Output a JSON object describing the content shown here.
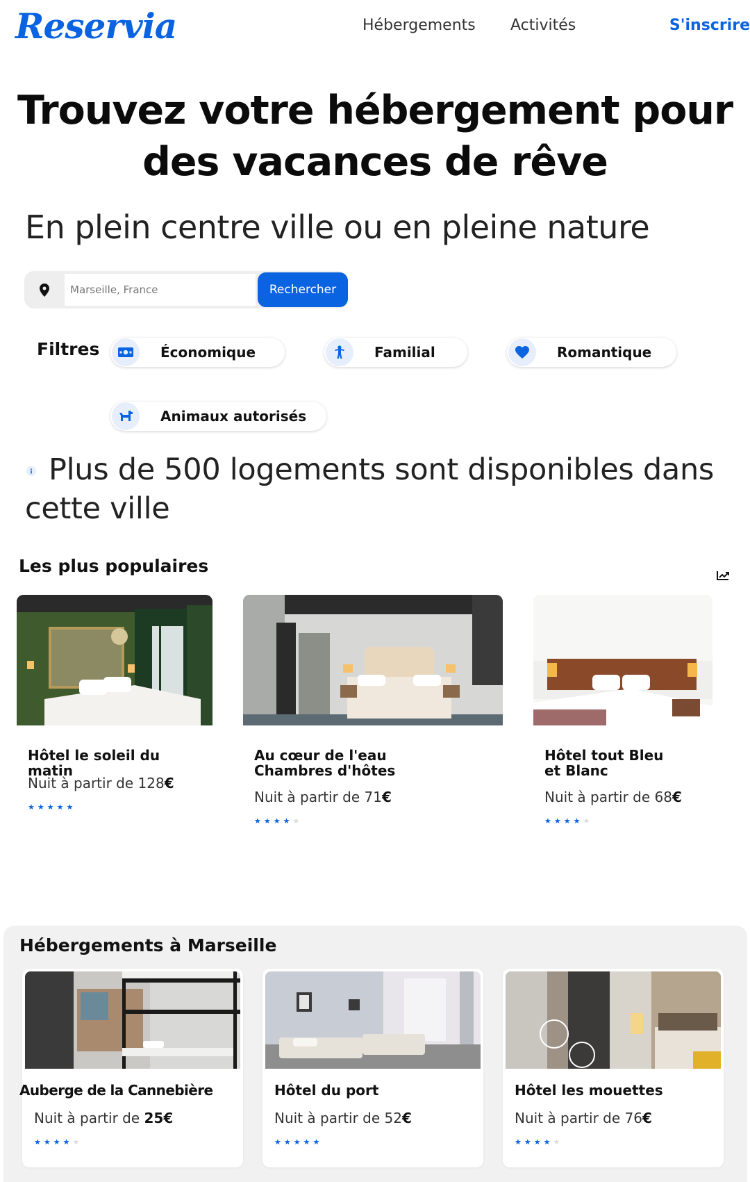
{
  "header": {
    "logo": "Reservia",
    "nav": [
      "Hébergements",
      "Activités"
    ],
    "signup": "S'inscrire"
  },
  "hero": {
    "title_line1": "Trouvez votre hébergement pour",
    "title_line2": "des vacances de rêve",
    "subtitle": "En plein centre ville ou en pleine nature"
  },
  "search": {
    "placeholder": "Marseille, France",
    "button": "Rechercher"
  },
  "filters": {
    "label": "Filtres",
    "items": [
      {
        "label": "Économique",
        "icon": "money-icon"
      },
      {
        "label": "Familial",
        "icon": "child-icon"
      },
      {
        "label": "Romantique",
        "icon": "heart-icon"
      },
      {
        "label": "Animaux autorisés",
        "icon": "dog-icon"
      }
    ]
  },
  "availability": "Plus de 500 logements sont disponibles dans cette ville",
  "popular": {
    "title": "Les plus populaires",
    "cards": [
      {
        "name": "Hôtel le soleil du matin",
        "price_prefix": "Nuit à partir de 128",
        "currency": "€",
        "rating": 5
      },
      {
        "name": "Au cœur de l'eau Chambres d'hôtes",
        "price_prefix": "Nuit à partir de 71",
        "currency": "€",
        "rating": 4
      },
      {
        "name": "Hôtel tout Bleu et Blanc",
        "price_prefix": "Nuit à partir de 68",
        "currency": "€",
        "rating": 4
      }
    ]
  },
  "marseille": {
    "title": "Hébergements à Marseille",
    "cards": [
      {
        "name": "Auberge de la Cannebière",
        "price_prefix": "Nuit à partir de ",
        "price_bold": "25€",
        "rating": 4
      },
      {
        "name": "Hôtel du port",
        "price_prefix": "Nuit à partir de 52",
        "price_bold": "€",
        "rating": 5
      },
      {
        "name": "Hôtel les mouettes",
        "price_prefix": "Nuit à partir de 76",
        "price_bold": "€",
        "rating": 4
      }
    ]
  },
  "colors": {
    "primary": "#0a63e0",
    "chip_bg": "#e6eefb",
    "section_bg": "#f1f1f1"
  }
}
